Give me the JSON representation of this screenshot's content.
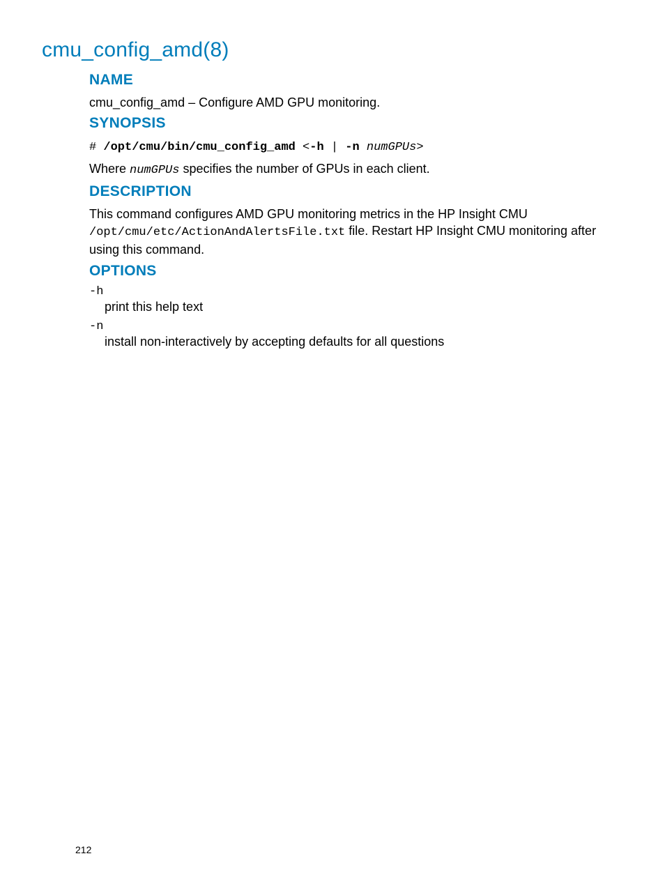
{
  "title": "cmu_config_amd(8)",
  "sections": {
    "name": {
      "heading": "NAME",
      "text": "cmu_config_amd – Configure AMD GPU monitoring."
    },
    "synopsis": {
      "heading": "SYNOPSIS",
      "prompt": "# ",
      "cmd": "/opt/cmu/bin/cmu_config_amd",
      "open": " <",
      "flag_h": "-h",
      "sep": " | ",
      "flag_n": "-n",
      "space": " ",
      "arg": "numGPUs",
      "close": ">",
      "where_pre": "Where ",
      "where_var": "numGPUs",
      "where_post": " specifies the number of GPUs in each client."
    },
    "description": {
      "heading": "DESCRIPTION",
      "pre": "This command configures AMD GPU monitoring metrics in the HP Insight CMU ",
      "path": "/opt/cmu/etc/ActionAndAlertsFile.txt",
      "post": " file. Restart HP Insight CMU monitoring after using this command."
    },
    "options": {
      "heading": "OPTIONS",
      "items": [
        {
          "flag": "-h",
          "desc": "print this help text"
        },
        {
          "flag": "-n",
          "desc": "install non-interactively by accepting defaults for all questions"
        }
      ]
    }
  },
  "page_number": "212"
}
